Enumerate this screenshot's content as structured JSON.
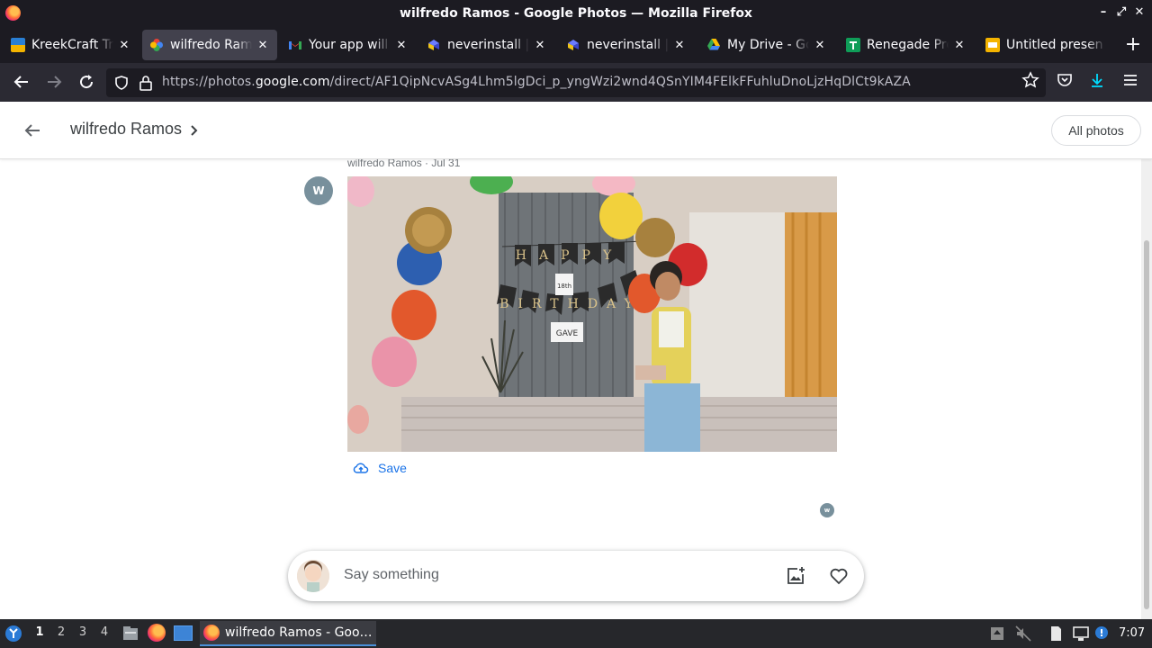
{
  "window": {
    "title": "wilfredo Ramos - Google Photos — Mozilla Firefox"
  },
  "tabs": [
    {
      "label": "KreekCraft Tre",
      "icon": "kreekcraft-favicon",
      "color": "#f4b400"
    },
    {
      "label": "wilfredo Ramos",
      "icon": "google-photos-favicon",
      "active": true
    },
    {
      "label": "Your app will b",
      "icon": "gmail-favicon"
    },
    {
      "label": "neverinstall | Y",
      "icon": "neverinstall-favicon"
    },
    {
      "label": "neverinstall | Y",
      "icon": "neverinstall-favicon"
    },
    {
      "label": "My Drive - Goo",
      "icon": "google-drive-favicon"
    },
    {
      "label": "Renegade Proj",
      "icon": "google-sheets-favicon"
    },
    {
      "label": "Untitled presen",
      "icon": "google-slides-favicon"
    }
  ],
  "navbar": {
    "url_prefix": "https://photos.",
    "url_domain": "google.com",
    "url_path": "/direct/AF1QipNcvASg4Lhm5lgDci_p_yngWzi2wnd4QSnYIM4FElkFFuhluDnoLjzHqDlCt9kAZA"
  },
  "header": {
    "title": "wilfredo Ramos",
    "all_photos_label": "All photos"
  },
  "post": {
    "meta": "wilfredo Ramos · Jul 31",
    "avatar_letter": "W",
    "save_label": "Save",
    "mini_avatar_letter": "w",
    "photo": {
      "banner_top": "HAPPY",
      "banner_bottom": "BIRTHDAY",
      "sign_age": "18th",
      "sign_name": "GAVE"
    }
  },
  "comment": {
    "placeholder": "Say something"
  },
  "taskbar": {
    "workspaces": [
      "1",
      "2",
      "3",
      "4"
    ],
    "app_label": "wilfredo Ramos - Goo…",
    "clock": "7:07"
  },
  "colors": {
    "accent": "#1a73e8",
    "titlebar_bg": "#1c1b22",
    "navbar_bg": "#2b2a33"
  }
}
